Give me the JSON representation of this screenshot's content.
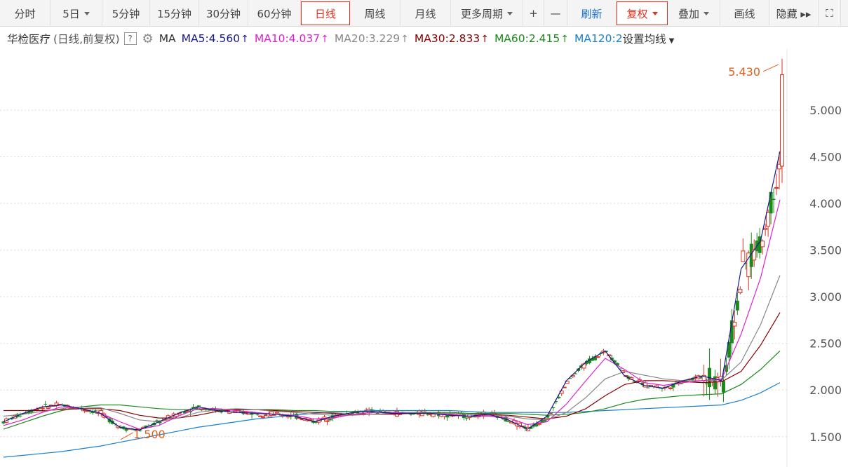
{
  "toolbar": {
    "items": [
      {
        "label": "分时",
        "w": 72,
        "caret": false,
        "active": false,
        "blue": false,
        "name": "tab-intraday"
      },
      {
        "label": "5日",
        "w": 74,
        "caret": true,
        "active": false,
        "blue": false,
        "name": "tab-5day"
      },
      {
        "label": "5分钟",
        "w": 68,
        "caret": false,
        "active": false,
        "blue": false,
        "name": "tab-5min"
      },
      {
        "label": "15分钟",
        "w": 70,
        "caret": false,
        "active": false,
        "blue": false,
        "name": "tab-15min"
      },
      {
        "label": "30分钟",
        "w": 70,
        "caret": false,
        "active": false,
        "blue": false,
        "name": "tab-30min"
      },
      {
        "label": "60分钟",
        "w": 75,
        "caret": false,
        "active": false,
        "blue": false,
        "name": "tab-60min"
      },
      {
        "label": "日线",
        "w": 70,
        "caret": false,
        "active": true,
        "blue": false,
        "name": "tab-daily"
      },
      {
        "label": "周线",
        "w": 72,
        "caret": false,
        "active": false,
        "blue": false,
        "name": "tab-weekly"
      },
      {
        "label": "月线",
        "w": 72,
        "caret": false,
        "active": false,
        "blue": false,
        "name": "tab-monthly"
      },
      {
        "label": "更多周期",
        "w": 103,
        "caret": true,
        "active": false,
        "blue": false,
        "name": "tab-more-periods"
      },
      {
        "label": "+",
        "w": 30,
        "caret": false,
        "active": false,
        "blue": false,
        "name": "zoom-in-button"
      },
      {
        "label": "—",
        "w": 33,
        "caret": false,
        "active": false,
        "blue": false,
        "name": "zoom-out-button"
      },
      {
        "label": "刷新",
        "w": 70,
        "caret": false,
        "active": false,
        "blue": true,
        "name": "refresh-button"
      },
      {
        "label": "复权",
        "w": 73,
        "caret": true,
        "active": true,
        "blue": false,
        "name": "adjust-dropdown"
      },
      {
        "label": "叠加",
        "w": 75,
        "caret": true,
        "active": false,
        "blue": false,
        "name": "overlay-dropdown"
      },
      {
        "label": "画线",
        "w": 70,
        "caret": false,
        "active": false,
        "blue": false,
        "name": "draw-line-button"
      },
      {
        "label": "隐藏 ▸▸",
        "w": 70,
        "caret": false,
        "active": false,
        "blue": false,
        "name": "hide-button"
      },
      {
        "label": "⛶",
        "w": 32,
        "caret": false,
        "active": false,
        "blue": false,
        "name": "fullscreen-button"
      }
    ]
  },
  "info": {
    "stock_name": "华检医疗",
    "mode": "(日线,前复权)",
    "help": "?",
    "ma_label": "MA",
    "ma5": "MA5:4.560",
    "ma10": "MA10:4.037",
    "ma20": "MA20:3.229",
    "ma30": "MA30:2.833",
    "ma60": "MA60:2.415",
    "ma120": "MA120:2",
    "arrow": "↑",
    "settings": "设置均线",
    "colors": {
      "ma5": "#1a1a8c",
      "ma10": "#e020d0",
      "ma20": "#888888",
      "ma30": "#8b0000",
      "ma60": "#1a8a1a",
      "ma120": "#1a7fd1"
    }
  },
  "chart_data": {
    "type": "candlestick",
    "price_labels": [
      "5.000",
      "4.500",
      "4.000",
      "3.500",
      "3.000",
      "2.500",
      "2.000",
      "1.500"
    ],
    "price_values": [
      5.0,
      4.5,
      4.0,
      3.5,
      3.0,
      2.5,
      2.0,
      1.5
    ],
    "ylim": [
      1.22,
      5.58
    ],
    "high_annotation": {
      "label": "5.430",
      "value": 5.43
    },
    "low_annotation": {
      "label": "1.500",
      "value": 1.5
    },
    "up_color": "#e0301e",
    "down_color": "#1a8a1a",
    "grid": true,
    "ohlc": [],
    "ma_series": {
      "ma5": [
        1.66,
        1.75,
        1.82,
        1.84,
        1.8,
        1.75,
        1.6,
        1.57,
        1.66,
        1.75,
        1.82,
        1.78,
        1.76,
        1.75,
        1.74,
        1.72,
        1.66,
        1.72,
        1.76,
        1.77,
        1.75,
        1.75,
        1.75,
        1.73,
        1.72,
        1.74,
        1.68,
        1.58,
        1.72,
        2.1,
        2.3,
        2.42,
        2.15,
        2.05,
        2.02,
        2.1,
        2.15,
        2.1,
        3.3,
        3.6,
        4.56
      ],
      "ma10": [
        1.62,
        1.68,
        1.76,
        1.82,
        1.8,
        1.75,
        1.66,
        1.58,
        1.62,
        1.72,
        1.8,
        1.8,
        1.78,
        1.76,
        1.74,
        1.73,
        1.69,
        1.7,
        1.74,
        1.76,
        1.76,
        1.75,
        1.75,
        1.74,
        1.72,
        1.72,
        1.7,
        1.63,
        1.66,
        1.85,
        2.1,
        2.34,
        2.22,
        2.08,
        2.05,
        2.08,
        2.1,
        2.12,
        2.6,
        3.2,
        4.04
      ],
      "ma20": [
        1.72,
        1.74,
        1.77,
        1.8,
        1.82,
        1.81,
        1.75,
        1.68,
        1.66,
        1.7,
        1.76,
        1.79,
        1.8,
        1.79,
        1.77,
        1.76,
        1.74,
        1.73,
        1.73,
        1.74,
        1.75,
        1.76,
        1.75,
        1.75,
        1.74,
        1.73,
        1.72,
        1.69,
        1.68,
        1.76,
        1.92,
        2.12,
        2.2,
        2.16,
        2.12,
        2.1,
        2.1,
        2.11,
        2.3,
        2.7,
        3.23
      ],
      "ma30": [
        1.78,
        1.78,
        1.78,
        1.79,
        1.8,
        1.8,
        1.78,
        1.73,
        1.7,
        1.7,
        1.73,
        1.77,
        1.79,
        1.79,
        1.78,
        1.77,
        1.76,
        1.75,
        1.74,
        1.74,
        1.74,
        1.75,
        1.75,
        1.75,
        1.74,
        1.74,
        1.73,
        1.71,
        1.69,
        1.72,
        1.8,
        1.94,
        2.06,
        2.1,
        2.1,
        2.09,
        2.08,
        2.09,
        2.2,
        2.48,
        2.83
      ],
      "ma60": [
        1.58,
        1.65,
        1.72,
        1.78,
        1.82,
        1.84,
        1.84,
        1.82,
        1.8,
        1.79,
        1.79,
        1.79,
        1.79,
        1.79,
        1.79,
        1.78,
        1.78,
        1.77,
        1.77,
        1.77,
        1.76,
        1.76,
        1.76,
        1.76,
        1.75,
        1.75,
        1.75,
        1.74,
        1.73,
        1.74,
        1.76,
        1.8,
        1.86,
        1.9,
        1.92,
        1.94,
        1.95,
        1.96,
        2.06,
        2.22,
        2.42
      ],
      "ma120": [
        1.28,
        1.3,
        1.32,
        1.34,
        1.37,
        1.4,
        1.44,
        1.48,
        1.52,
        1.56,
        1.6,
        1.63,
        1.66,
        1.69,
        1.71,
        1.73,
        1.75,
        1.76,
        1.77,
        1.78,
        1.78,
        1.78,
        1.78,
        1.78,
        1.77,
        1.76,
        1.76,
        1.76,
        1.76,
        1.76,
        1.77,
        1.78,
        1.79,
        1.8,
        1.81,
        1.82,
        1.83,
        1.84,
        1.89,
        1.97,
        2.08
      ]
    }
  }
}
